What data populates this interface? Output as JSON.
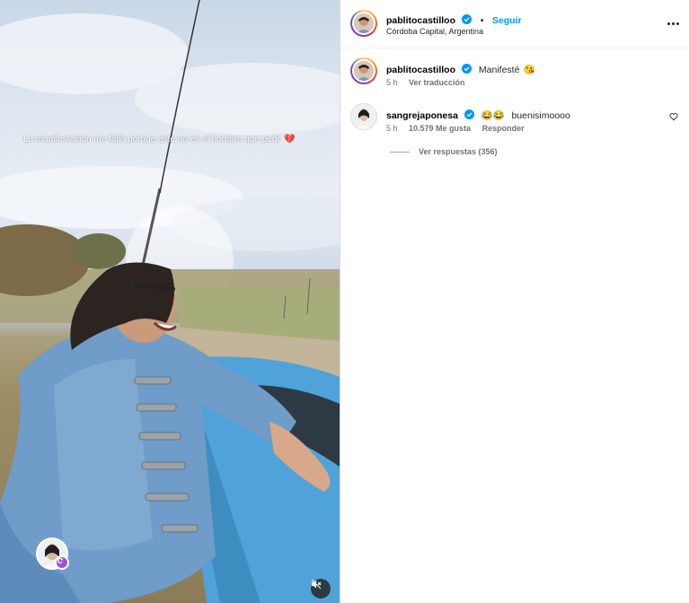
{
  "post": {
    "media": {
      "caption_overlay": "La manifestación me falló porque este no es el hombre que pedí",
      "caption_emoji": "💔",
      "mute_icon": "muted-speaker-icon",
      "collab_badge_icon": "collab-refresh-icon"
    },
    "header": {
      "username": "pablitocastilloo",
      "separator": "•",
      "follow_label": "Seguir",
      "location": "Córdoba Capital, Argentina",
      "more_icon": "more-horizontal-icon"
    },
    "caption": {
      "username": "pablitocastilloo",
      "text": "Manifesté",
      "emoji": "😘",
      "time": "5 h",
      "translate_label": "Ver traducción"
    },
    "comments": [
      {
        "username": "sangrejaponesa",
        "emojis": "😂😂",
        "text": "buenisimoooo",
        "time": "5 h",
        "likes": "10.579 Me gusta",
        "reply_label": "Responder",
        "replies_label": "Ver respuestas (356)"
      }
    ],
    "colors": {
      "link_blue": "#0095f6",
      "verified_blue": "#0095f6",
      "meta_gray": "#737373",
      "heart_red": "#e23a4b"
    }
  }
}
